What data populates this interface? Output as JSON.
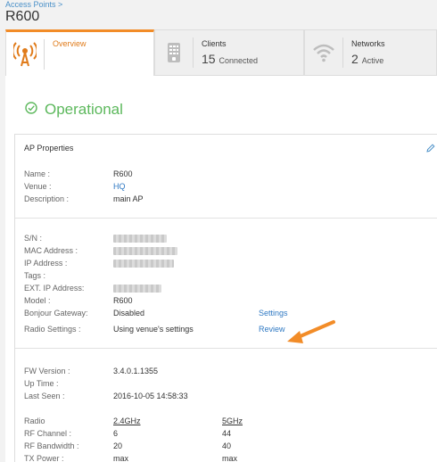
{
  "header": {
    "breadcrumb": "Access Points >",
    "title": "R600"
  },
  "tabs": [
    {
      "label": "Overview",
      "icon": "wifi-tower-icon"
    },
    {
      "label": "Clients",
      "count": "15",
      "count_suffix": "Connected",
      "icon": "device-icon"
    },
    {
      "label": "Networks",
      "count": "2",
      "count_suffix": "Active",
      "icon": "wifi-icon"
    }
  ],
  "status": {
    "label": "Operational",
    "icon": "check-circle-icon",
    "color": "#5cb85c"
  },
  "ap_properties": {
    "title": "AP Properties",
    "edit_icon": "pencil-icon",
    "name_label": "Name :",
    "name_value": "R600",
    "venue_label": "Venue :",
    "venue_value": "HQ",
    "description_label": "Description :",
    "description_value": "main AP",
    "sn_label": "S/N :",
    "mac_label": "MAC Address :",
    "ip_label": "IP Address :",
    "tags_label": "Tags :",
    "ext_ip_label": "EXT. IP Address:",
    "model_label": "Model :",
    "model_value": "R600",
    "bonjour_label": "Bonjour Gateway:",
    "bonjour_value": "Disabled",
    "bonjour_link": "Settings",
    "radio_label": "Radio Settings :",
    "radio_value": "Using venue's settings",
    "radio_link": "Review",
    "fw_label": "FW Version :",
    "fw_value": "3.4.0.1.1355",
    "uptime_label": "Up Time :",
    "last_seen_label": "Last Seen :",
    "last_seen_value": "2016-10-05 14:58:33",
    "radio_table": {
      "header_label": "Radio",
      "col1": "2.4GHz",
      "col2": "5GHz",
      "rows": [
        {
          "label": "RF Channel :",
          "v1": "6",
          "v2": "44"
        },
        {
          "label": "RF Bandwidth :",
          "v1": "20",
          "v2": "40"
        },
        {
          "label": "TX Power :",
          "v1": "max",
          "v2": "max"
        }
      ]
    }
  },
  "colors": {
    "accent": "#f28c28",
    "link": "#2f79c3",
    "success": "#5cb85c"
  }
}
